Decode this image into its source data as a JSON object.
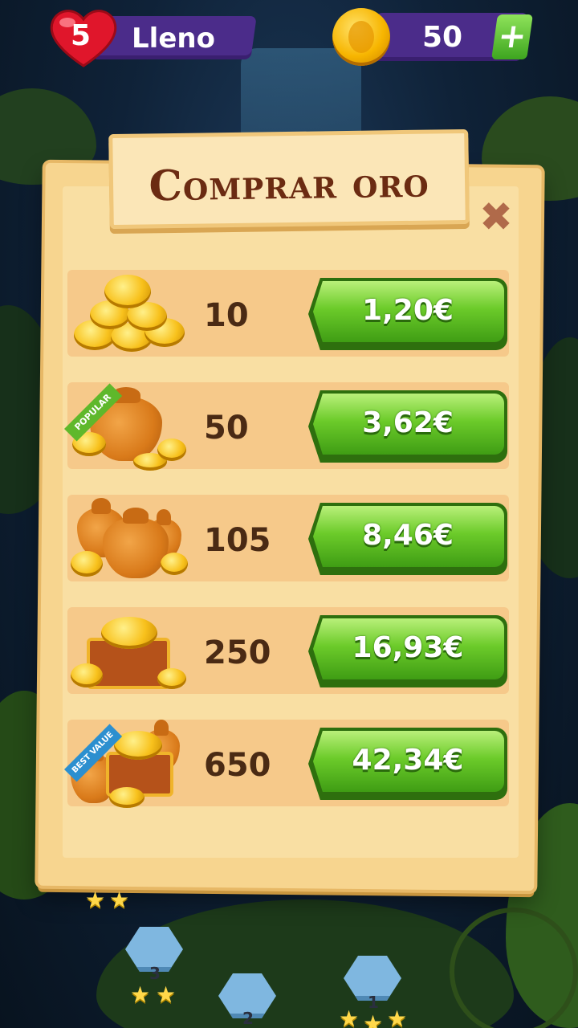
{
  "hud": {
    "lives_count": "5",
    "lives_label": "Lleno",
    "gold_amount": "50",
    "add_gold_symbol": "+",
    "colors": {
      "bar": "#4b2c8a",
      "plus": "#5cc22a",
      "heart": "#e0162b",
      "coin": "#f7b500"
    }
  },
  "dialog": {
    "title": "Comprar oro",
    "close_symbol": "✖",
    "packages": [
      {
        "quantity": "10",
        "price": "1,20€",
        "art": "coin-pile-icon",
        "badge": ""
      },
      {
        "quantity": "50",
        "price": "3,62€",
        "art": "gold-bag-icon",
        "badge": "POPULAR"
      },
      {
        "quantity": "105",
        "price": "8,46€",
        "art": "gold-bags-icon",
        "badge": ""
      },
      {
        "quantity": "250",
        "price": "16,93€",
        "art": "treasure-chest-icon",
        "badge": ""
      },
      {
        "quantity": "650",
        "price": "42,34€",
        "art": "chest-and-bags-icon",
        "badge": "BEST VALUE"
      }
    ]
  },
  "map": {
    "levels": [
      {
        "number": "3"
      },
      {
        "number": "2"
      },
      {
        "number": "1"
      }
    ]
  }
}
